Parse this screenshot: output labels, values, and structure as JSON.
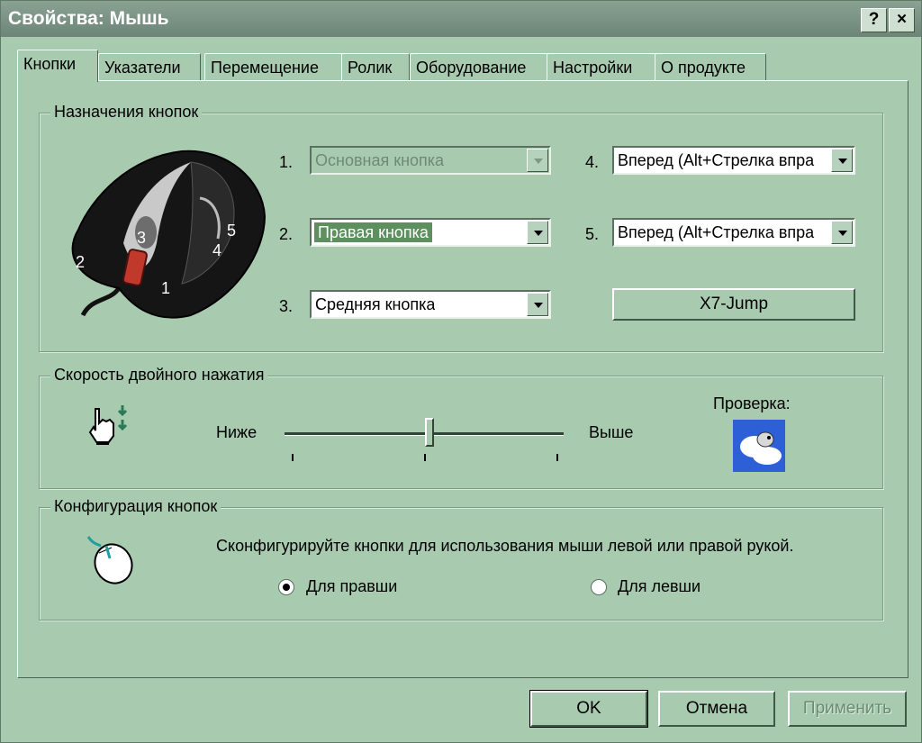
{
  "window": {
    "title": "Свойства: Мышь",
    "help": "?",
    "close": "×"
  },
  "tabs": [
    "Кнопки",
    "Указатели",
    "Перемещение",
    "Ролик",
    "Оборудование",
    "Настройки",
    "О продукте"
  ],
  "buttons_group": {
    "label": "Назначения кнопок",
    "mouse_labels": [
      "1",
      "2",
      "3",
      "4",
      "5"
    ],
    "assignments": [
      {
        "num": "1.",
        "value": "Основная кнопка",
        "state": "disabled"
      },
      {
        "num": "2.",
        "value": "Правая кнопка",
        "state": "selected"
      },
      {
        "num": "3.",
        "value": "Средняя кнопка",
        "state": "normal"
      },
      {
        "num": "4.",
        "value": "Вперед (Alt+Стрелка впра",
        "state": "normal"
      },
      {
        "num": "5.",
        "value": "Вперед (Alt+Стрелка впра",
        "state": "normal"
      }
    ],
    "x7_button": "X7-Jump"
  },
  "speed_group": {
    "label": "Скорость двойного нажатия",
    "low": "Ниже",
    "high": "Выше",
    "slider_value": 0.52,
    "test_label": "Проверка:"
  },
  "config_group": {
    "label": "Конфигурация кнопок",
    "description": "Сконфигурируйте кнопки для использования мыши левой или правой рукой.",
    "right_hand": "Для правши",
    "left_hand": "Для левши",
    "selected": "right"
  },
  "footer": {
    "ok": "OK",
    "cancel": "Отмена",
    "apply": "Применить"
  }
}
